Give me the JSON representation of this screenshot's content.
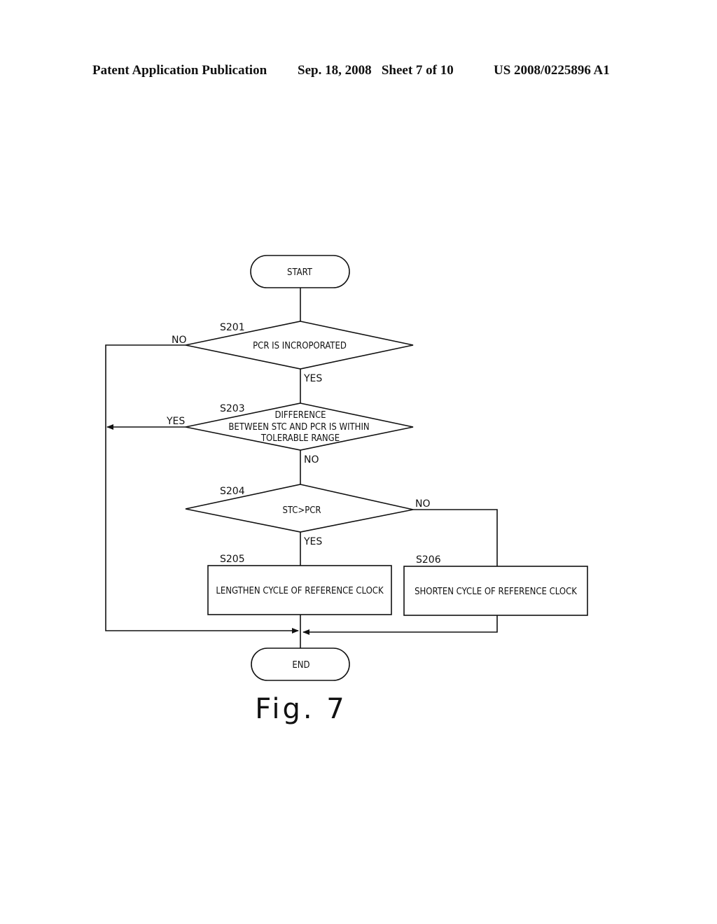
{
  "header": {
    "left": "Patent Application Publication",
    "date_sheet": "Sep. 18, 2008   Sheet 7 of 10",
    "number": "US 2008/0225896 A1"
  },
  "flowchart": {
    "start": "START",
    "end": "END",
    "s201": {
      "step": "S201",
      "text": "PCR IS INCROPORATED",
      "no": "NO",
      "yes": "YES"
    },
    "s203": {
      "step": "S203",
      "lines": [
        "DIFFERENCE",
        "BETWEEN STC AND PCR IS WITHIN",
        "TOLERABLE RANGE"
      ],
      "yes": "YES",
      "no": "NO"
    },
    "s204": {
      "step": "S204",
      "text": "STC>PCR",
      "no": "NO",
      "yes": "YES"
    },
    "s205": {
      "step": "S205",
      "text": "LENGTHEN CYCLE OF REFERENCE CLOCK"
    },
    "s206": {
      "step": "S206",
      "text": "SHORTEN CYCLE OF REFERENCE CLOCK"
    }
  },
  "caption": "Fig. 7"
}
